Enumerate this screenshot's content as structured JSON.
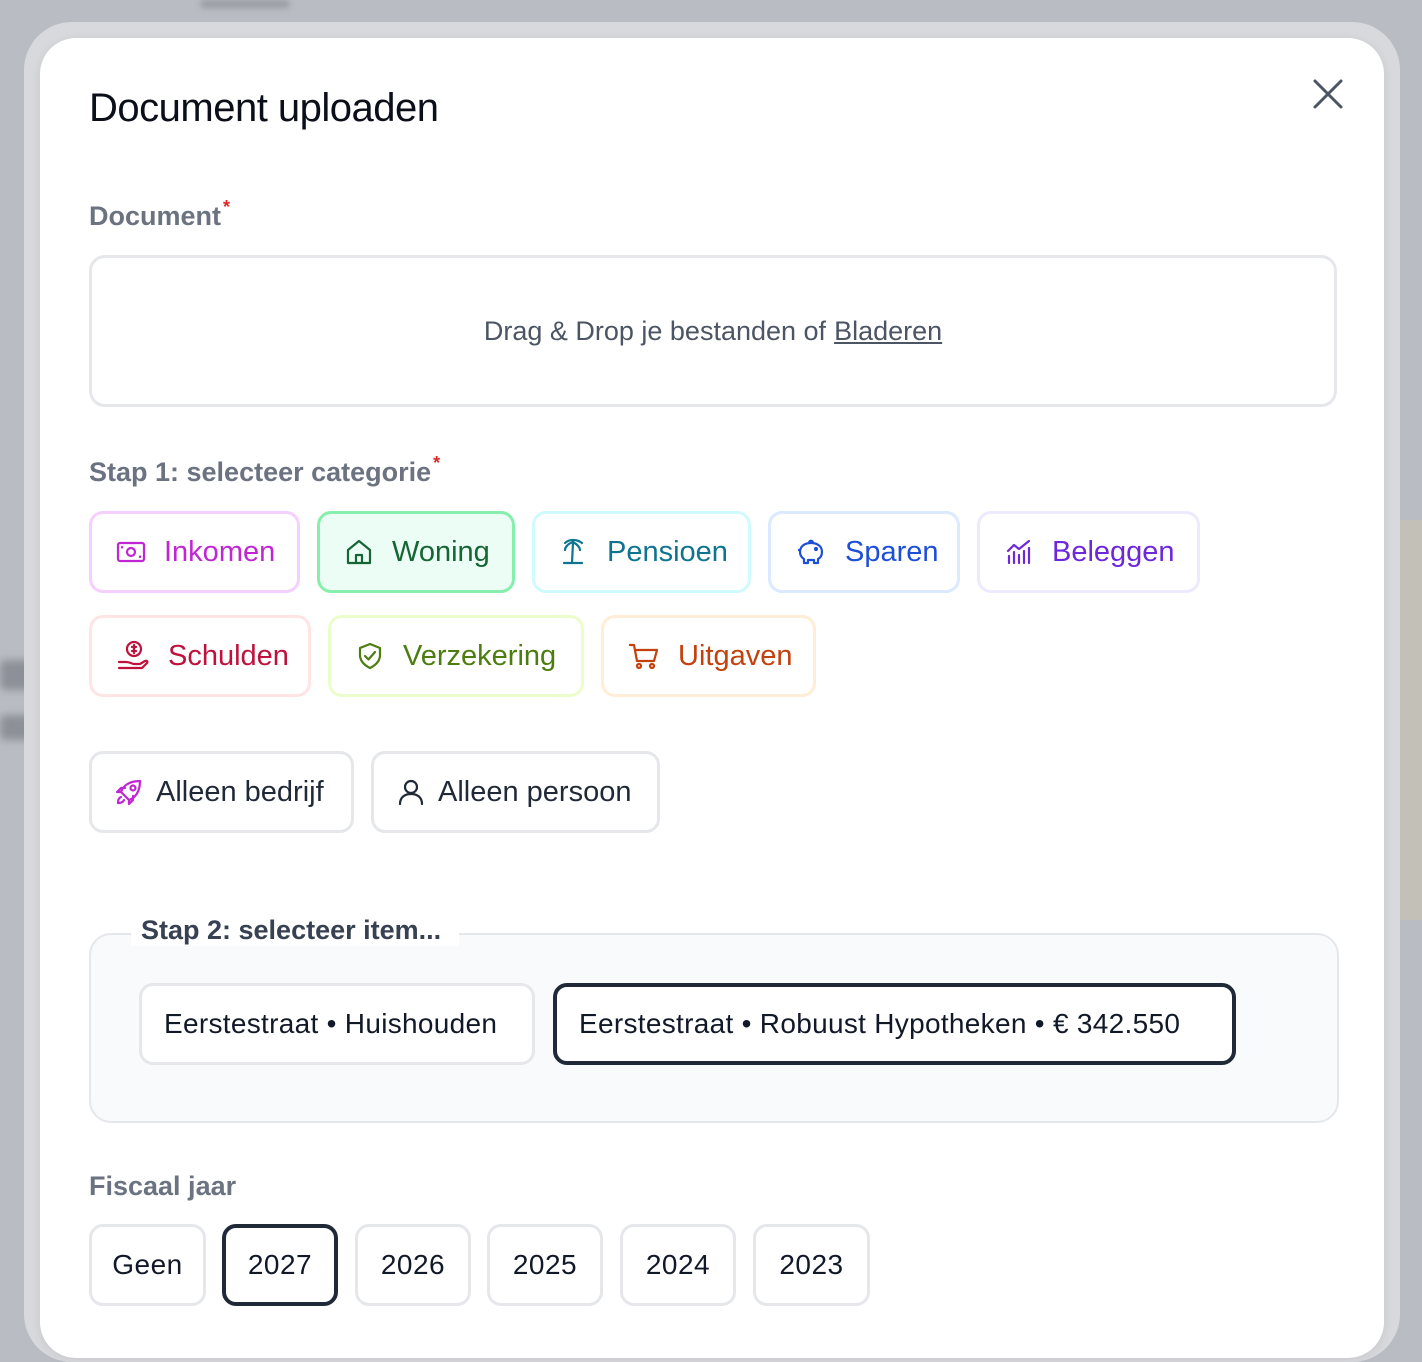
{
  "modal": {
    "title": "Document uploaden",
    "close_icon": "close-icon"
  },
  "document": {
    "label": "Document",
    "required_mark": "*",
    "dropzone_text": "Drag & Drop je bestanden of",
    "browse_link": "Bladeren"
  },
  "step1": {
    "label": "Stap 1: selecteer categorie",
    "required_mark": "*",
    "selected": "Woning",
    "categories": [
      {
        "label": "Inkomen",
        "icon": "banknote-icon",
        "color": "#c026d3",
        "border": "#f5d0fe"
      },
      {
        "label": "Woning",
        "icon": "house-icon",
        "color": "#166534",
        "border": "#86efac",
        "bg": "#ecfdf5"
      },
      {
        "label": "Pensioen",
        "icon": "palm-tree-icon",
        "color": "#0e7490",
        "border": "#cffafe"
      },
      {
        "label": "Sparen",
        "icon": "piggy-bank-icon",
        "color": "#1d4ed8",
        "border": "#dbeafe"
      },
      {
        "label": "Beleggen",
        "icon": "chart-icon",
        "color": "#6d28d9",
        "border": "#ede9fe"
      },
      {
        "label": "Schulden",
        "icon": "hand-coin-icon",
        "color": "#be123c",
        "border": "#ffe4e6"
      },
      {
        "label": "Verzekering",
        "icon": "shield-check-icon",
        "color": "#4d7c0f",
        "border": "#ecfccb"
      },
      {
        "label": "Uitgaven",
        "icon": "cart-icon",
        "color": "#c2410c",
        "border": "#ffedd5"
      }
    ],
    "filters": [
      {
        "label": "Alleen bedrijf",
        "icon": "rocket-icon"
      },
      {
        "label": "Alleen persoon",
        "icon": "user-icon"
      }
    ]
  },
  "step2": {
    "label": "Stap 2: selecteer item...",
    "items": [
      {
        "label": "Eerstestraat • Huishouden",
        "selected": false
      },
      {
        "label": "Eerstestraat • Robuust Hypotheken • € 342.550",
        "selected": true
      }
    ]
  },
  "fiscal_year": {
    "label": "Fiscaal jaar",
    "selected": "2027",
    "options": [
      "Geen",
      "2027",
      "2026",
      "2025",
      "2024",
      "2023"
    ]
  }
}
